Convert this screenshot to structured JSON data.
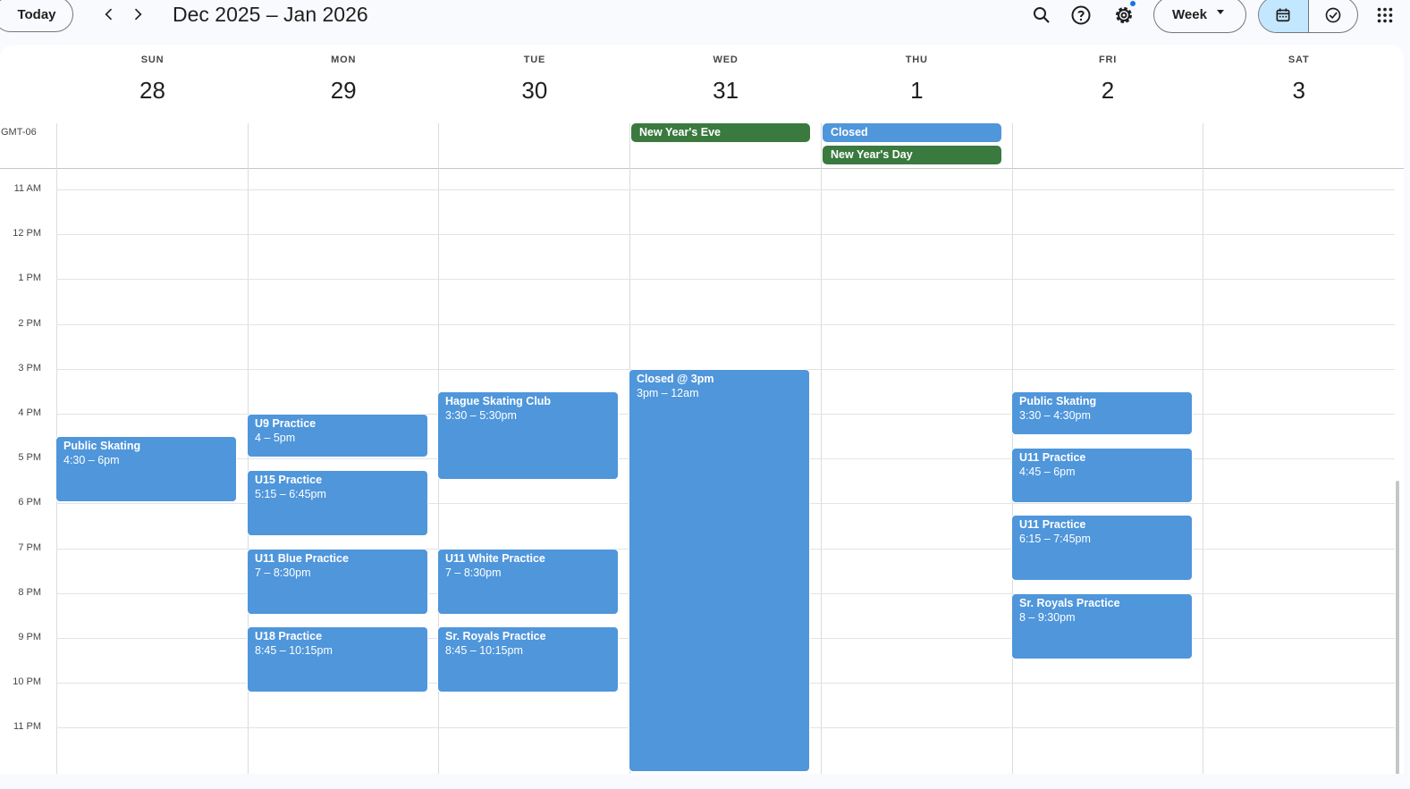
{
  "toolbar": {
    "today_label": "Today",
    "date_range": "Dec 2025 – Jan 2026",
    "view_label": "Week"
  },
  "icons": {
    "prev": "chevron-left-icon",
    "next": "chevron-right-icon",
    "search": "search-icon",
    "help": "help-icon",
    "settings": "gear-icon",
    "calendar_mode": "calendar-icon",
    "tasks_mode": "task-check-icon",
    "apps": "apps-grid-icon"
  },
  "colors": {
    "event_blue": "#4f96db",
    "holiday_green": "#3a7a3f",
    "accent": "#1a73e8",
    "active_mode": "#c2e7ff"
  },
  "timezone": "GMT-06",
  "days": [
    {
      "dow": "SUN",
      "num": "28"
    },
    {
      "dow": "MON",
      "num": "29"
    },
    {
      "dow": "TUE",
      "num": "30"
    },
    {
      "dow": "WED",
      "num": "31"
    },
    {
      "dow": "THU",
      "num": "1"
    },
    {
      "dow": "FRI",
      "num": "2"
    },
    {
      "dow": "SAT",
      "num": "3"
    }
  ],
  "hours": [
    "11 AM",
    "12 PM",
    "1 PM",
    "2 PM",
    "3 PM",
    "4 PM",
    "5 PM",
    "6 PM",
    "7 PM",
    "8 PM",
    "9 PM",
    "10 PM",
    "11 PM"
  ],
  "all_day_events": [
    {
      "title": "New Year's Eve",
      "day": 3,
      "row": 0,
      "color": "green"
    },
    {
      "title": "Closed",
      "day": 4,
      "row": 0,
      "color": "blue"
    },
    {
      "title": "New Year's Day",
      "day": 4,
      "row": 1,
      "color": "green"
    }
  ],
  "events": [
    {
      "title": "Public Skating",
      "time": "4:30 – 6pm",
      "day": 0,
      "start": 16.5,
      "end": 18.0
    },
    {
      "title": "U9 Practice",
      "time": "4 – 5pm",
      "day": 1,
      "start": 16.0,
      "end": 17.0
    },
    {
      "title": "U15 Practice",
      "time": "5:15 – 6:45pm",
      "day": 1,
      "start": 17.25,
      "end": 18.75
    },
    {
      "title": "U11 Blue Practice",
      "time": "7 – 8:30pm",
      "day": 1,
      "start": 19.0,
      "end": 20.5
    },
    {
      "title": "U18 Practice",
      "time": "8:45 – 10:15pm",
      "day": 1,
      "start": 20.75,
      "end": 22.25
    },
    {
      "title": "Hague Skating Club",
      "time": "3:30 – 5:30pm",
      "day": 2,
      "start": 15.5,
      "end": 17.5
    },
    {
      "title": "U11 White Practice",
      "time": "7 – 8:30pm",
      "day": 2,
      "start": 19.0,
      "end": 20.5
    },
    {
      "title": "Sr. Royals Practice",
      "time": "8:45 – 10:15pm",
      "day": 2,
      "start": 20.75,
      "end": 22.25
    },
    {
      "title": "Closed @ 3pm",
      "time": "3pm – 12am",
      "day": 3,
      "start": 15.0,
      "end": 24.0
    },
    {
      "title": "Public Skating",
      "time": "3:30 – 4:30pm",
      "day": 5,
      "start": 15.5,
      "end": 16.5
    },
    {
      "title": "U11 Practice",
      "time": "4:45 – 6pm",
      "day": 5,
      "start": 16.75,
      "end": 18.0
    },
    {
      "title": "U11 Practice",
      "time": "6:15 – 7:45pm",
      "day": 5,
      "start": 18.25,
      "end": 19.75
    },
    {
      "title": "Sr. Royals Practice",
      "time": "8 – 9:30pm",
      "day": 5,
      "start": 20.0,
      "end": 21.5
    }
  ]
}
